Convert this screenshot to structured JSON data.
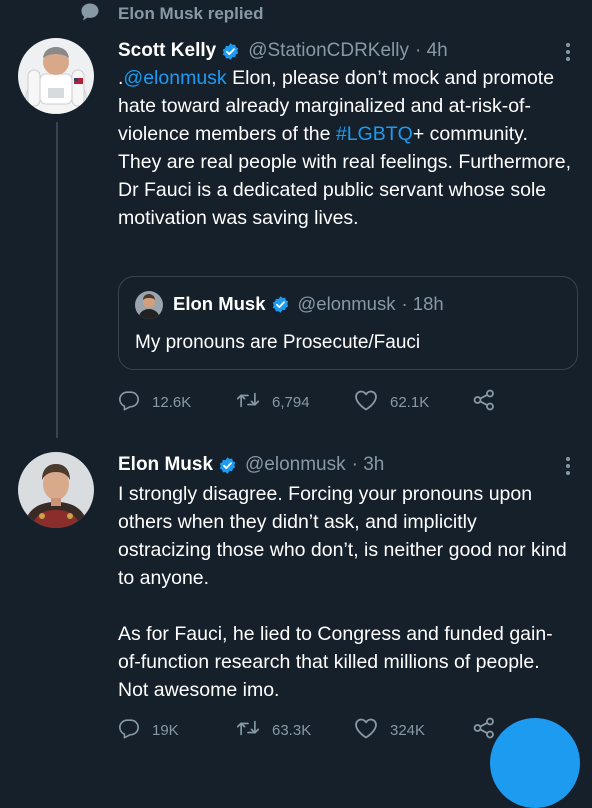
{
  "context": {
    "icon": "speech-bubble-icon",
    "label": "Elon Musk replied"
  },
  "tweet1": {
    "author": {
      "name": "Scott Kelly",
      "handle": "@StationCDRKelly",
      "time": "· 4h"
    },
    "text": {
      "prefix": ".",
      "mention": "@elonmusk",
      "part1": " Elon, please don’t mock and promote hate toward already marginalized and at-risk-of-violence members of the ",
      "hashtag": "#LGBTQ",
      "part2": "+ community. They are real people with real feelings. Furthermore, Dr Fauci is a dedicated public servant whose sole motivation was saving lives."
    },
    "quote": {
      "name": "Elon Musk",
      "handle": "@elonmusk",
      "time": "· 18h",
      "text": "My pronouns are Prosecute/Fauci"
    },
    "stats": {
      "replies": "12.6K",
      "retweets": "6,794",
      "likes": "62.1K"
    }
  },
  "tweet2": {
    "author": {
      "name": "Elon Musk",
      "handle": "@elonmusk",
      "time": "· 3h"
    },
    "text": {
      "para1": "I strongly disagree. Forcing your pronouns upon others when they didn’t ask, and implicitly ostracizing those who don’t, is neither good nor kind to anyone.",
      "para2": "As for Fauci, he lied to Congress and funded gain-of-function research that killed millions of people. Not awesome imo."
    },
    "stats": {
      "replies": "19K",
      "retweets": "63.3K",
      "likes": "324K"
    }
  },
  "colors": {
    "background": "#15202b",
    "accent": "#1d9bf0",
    "muted": "#8899a6",
    "border": "#38444d"
  }
}
